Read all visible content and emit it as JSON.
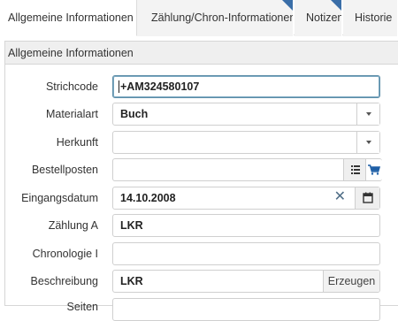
{
  "tabs": [
    {
      "label": "Allgemeine Informationen",
      "active": true
    },
    {
      "label": "Zählung/Chron-Informationen",
      "active": false
    },
    {
      "label": "Notizen",
      "active": false
    },
    {
      "label": "Historie",
      "active": false
    }
  ],
  "panel": {
    "title": "Allgemeine Informationen"
  },
  "form": {
    "strichcode": {
      "label": "Strichcode",
      "value": "+AM324580107"
    },
    "materialart": {
      "label": "Materialart",
      "value": "Buch"
    },
    "herkunft": {
      "label": "Herkunft",
      "value": ""
    },
    "bestellposten": {
      "label": "Bestellposten",
      "value": ""
    },
    "eingangsdatum": {
      "label": "Eingangsdatum",
      "value": "14.10.2008",
      "clear_glyph": "✕"
    },
    "zaehlung_a": {
      "label": "Zählung A",
      "value": "LKR"
    },
    "chronologie_i": {
      "label": "Chronologie I",
      "value": ""
    },
    "beschreibung": {
      "label": "Beschreibung",
      "value": "LKR",
      "button_label": "Erzeugen"
    },
    "seiten": {
      "label": "Seiten",
      "value": ""
    }
  },
  "icons": {
    "dropdown": "chevron-down-icon",
    "list": "list-icon",
    "cart": "shopping-cart-icon",
    "clear": "close-icon",
    "calendar": "calendar-icon"
  },
  "colors": {
    "tab_marker": "#3a6ea8",
    "focus_border": "#5d8ea8",
    "cart": "#1e5fa6"
  }
}
